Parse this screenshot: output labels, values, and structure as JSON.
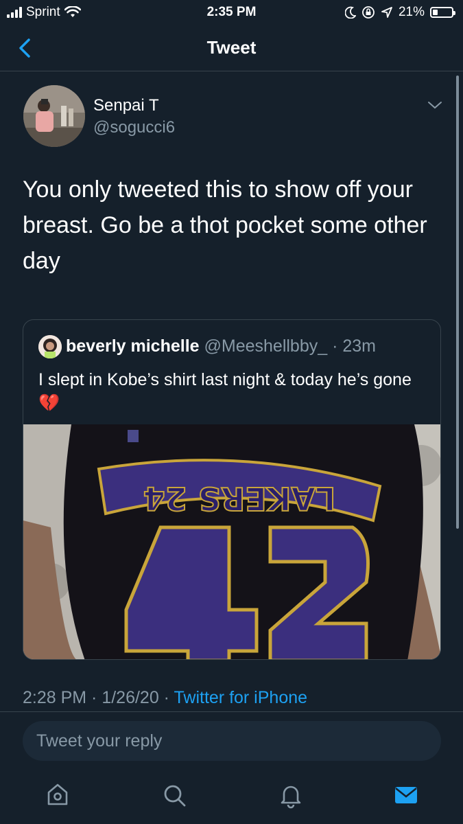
{
  "status_bar": {
    "carrier": "Sprint",
    "time": "2:35 PM",
    "battery": "21%"
  },
  "nav": {
    "title": "Tweet",
    "back_icon": "chevron-left-icon"
  },
  "tweet": {
    "author_name": "Senpai T",
    "author_handle": "@sogucci6",
    "text": "You only tweeted this to show off your breast. Go be a thot pocket some other day",
    "timestamp": "2:28 PM · 1/26/20 · ",
    "source": "Twitter for iPhone"
  },
  "quote": {
    "name": "beverly michelle",
    "handle_time": " @Meeshellbby_ · 23m",
    "text": "I slept in Kobe’s shirt last night & today he’s gone",
    "emoji": "💔",
    "image_text": "LAKERS 24"
  },
  "reply": {
    "placeholder": "Tweet your reply"
  },
  "tabs": [
    "home-icon",
    "search-icon",
    "notifications-icon",
    "messages-icon"
  ],
  "colors": {
    "background": "#15202b",
    "accent": "#1da1f2",
    "secondary_text": "#8899a6",
    "border": "#38444d"
  }
}
